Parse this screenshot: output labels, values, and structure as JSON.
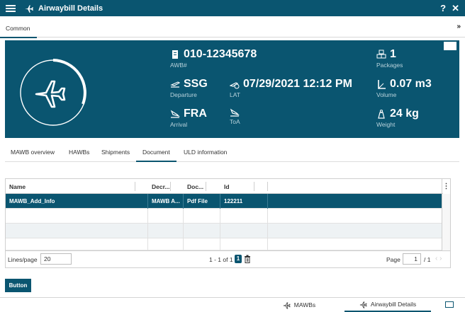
{
  "titlebar": {
    "title": "Airwaybill Details",
    "help": "?",
    "close": "✕"
  },
  "tabs": [
    {
      "label": "Common",
      "active": true
    }
  ],
  "colors": {
    "brand": "#0a5570",
    "label": "#b9d3dc",
    "selected_row": "#0a5570"
  },
  "hero": {
    "awb": {
      "value": "010-12345678",
      "label": "AWB#"
    },
    "packages": {
      "value": "1",
      "label": "Packages"
    },
    "departure": {
      "value": "SSG",
      "label": "Departure"
    },
    "lat": {
      "value": "07/29/2021 12:12 PM",
      "label": "LAT"
    },
    "volume": {
      "value": "0.07 m3",
      "label": "Volume"
    },
    "arrival": {
      "value": "FRA",
      "label": "Arrival"
    },
    "toa": {
      "value": "",
      "label": "ToA"
    },
    "weight": {
      "value": "24 kg",
      "label": "Weight"
    }
  },
  "subtabs": [
    {
      "label": "MAWB overview"
    },
    {
      "label": "HAWBs"
    },
    {
      "label": "Shipments"
    },
    {
      "label": "Document",
      "active": true
    },
    {
      "label": "ULD information"
    }
  ],
  "grid": {
    "columns": [
      "Name",
      "Decr...",
      "Doc...",
      "Id"
    ],
    "rows": [
      {
        "name": "MAWB_Add_Info",
        "descr": "MAWB A...",
        "doc": "Pdf File",
        "id": "122211"
      }
    ],
    "footer": {
      "lines_label": "Lines/page",
      "lines_value": "20",
      "range": "1 - 1 of 1",
      "page_badge": "1",
      "page_label": "Page",
      "page_value": "1",
      "page_total": "/ 1"
    }
  },
  "button": {
    "label": "Button"
  },
  "bottombar": {
    "items": [
      {
        "label": "MAWBs"
      },
      {
        "label": "Airwaybill Details",
        "active": true
      }
    ]
  }
}
